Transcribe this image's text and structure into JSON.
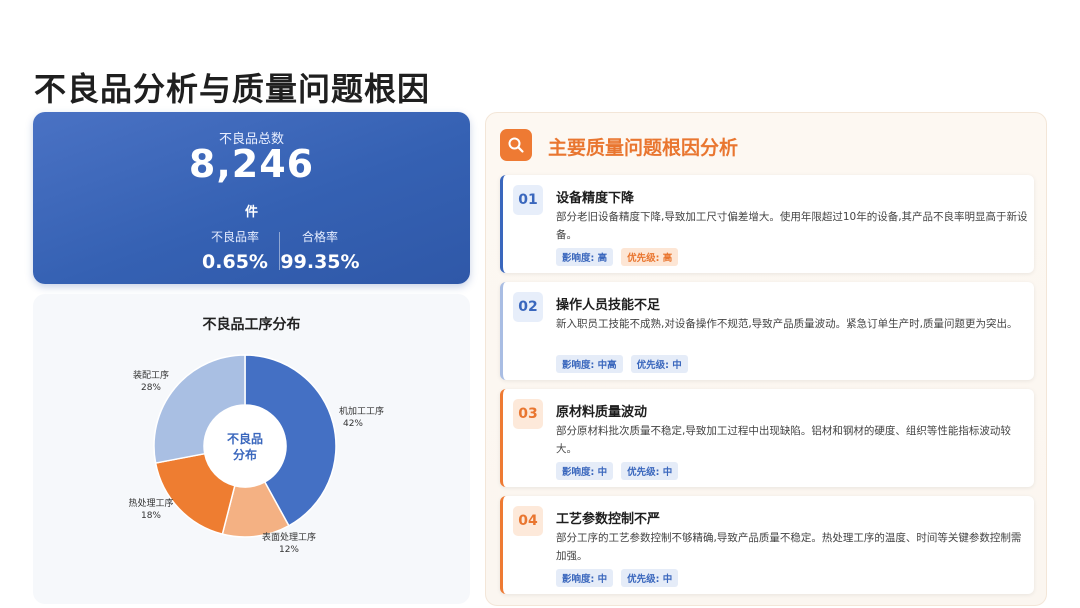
{
  "page": {
    "title": "不良品分析与质量问题根因"
  },
  "summary": {
    "label": "不良品总数",
    "value": "8,246",
    "unit": "件",
    "defect_rate_label": "不良品率",
    "defect_rate_value": "0.65%",
    "pass_rate_label": "合格率",
    "pass_rate_value": "99.35%"
  },
  "chart_data": {
    "type": "pie",
    "title": "不良品工序分布",
    "center_label_line1": "不良品",
    "center_label_line2": "分布",
    "categories": [
      "机加工工序",
      "表面处理工序",
      "热处理工序",
      "装配工序"
    ],
    "values": [
      42,
      12,
      18,
      28
    ],
    "value_labels": [
      "42%",
      "12%",
      "18%",
      "28%"
    ],
    "colors": [
      "#4470c4",
      "#f4b183",
      "#ee7d31",
      "#a9bfe3"
    ]
  },
  "panel": {
    "title": "主要质量问题根因分析",
    "icon": "search-icon",
    "causes": [
      {
        "num": "01",
        "title": "设备精度下降",
        "desc": "部分老旧设备精度下降,导致加工尺寸偏差增大。使用年限超过10年的设备,其产品不良率明显高于新设备。",
        "impact": "影响度: 高",
        "priority": "优先级: 高"
      },
      {
        "num": "02",
        "title": "操作人员技能不足",
        "desc": "新入职员工技能不成熟,对设备操作不规范,导致产品质量波动。紧急订单生产时,质量问题更为突出。",
        "impact": "影响度: 中高",
        "priority": "优先级: 中"
      },
      {
        "num": "03",
        "title": "原材料质量波动",
        "desc": "部分原材料批次质量不稳定,导致加工过程中出现缺陷。铝材和钢材的硬度、组织等性能指标波动较大。",
        "impact": "影响度: 中",
        "priority": "优先级: 中"
      },
      {
        "num": "04",
        "title": "工艺参数控制不严",
        "desc": "部分工序的工艺参数控制不够精确,导致产品质量不稳定。热处理工序的温度、时间等关键参数控制需加强。",
        "impact": "影响度: 中",
        "priority": "优先级: 中"
      }
    ]
  }
}
